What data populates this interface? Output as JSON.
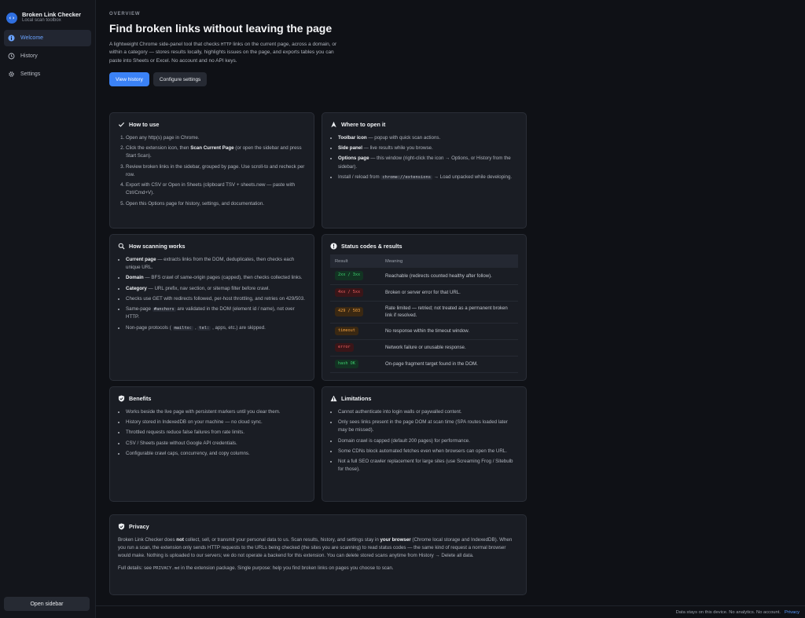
{
  "brand": {
    "title": "Broken Link Checker",
    "subtitle": "Local scan toolbox",
    "logo_glyph": "‹›"
  },
  "nav": {
    "items": [
      {
        "label": "Welcome",
        "icon": "info-icon",
        "active": true
      },
      {
        "label": "History",
        "icon": "history-icon"
      },
      {
        "label": "Settings",
        "icon": "gear-icon"
      }
    ]
  },
  "sidebar_button": "Open sidebar",
  "header": {
    "eyebrow": "OVERVIEW",
    "title": "Find broken links without leaving the page",
    "intro_1": "A lightweight Chrome side-panel tool that checks ",
    "intro_code": "HTTP",
    "intro_2": " links on the current page, across a domain, or within a category — stores results locally, highlights issues on the page, and exports tables you can paste into Sheets or Excel. No account and no API keys.",
    "btn_history": "View history",
    "btn_settings": "Configure settings"
  },
  "howto": {
    "title": "How to use",
    "s1": "Open any http(s) page in Chrome.",
    "s2a": "Click the extension icon, then ",
    "s2b": "Scan Current Page",
    "s2c": " (or open the sidebar and press Start Scan).",
    "s3": "Review broken links in the sidebar, grouped by page. Use scroll-to and recheck per row.",
    "s4": "Export with CSV or Open in Sheets (clipboard TSV + sheets.new — paste with Ctrl/Cmd+V).",
    "s5": "Open this Options page for history, settings, and documentation."
  },
  "where": {
    "title": "Where to open it",
    "i1b": "Toolbar icon",
    "i1": " — popup with quick scan actions.",
    "i2b": "Side panel",
    "i2": " — live results while you browse.",
    "i3b": "Options page",
    "i3": " — this window (right-click the icon → Options, or History from the sidebar).",
    "i4a": "Install / reload from ",
    "i4code": "chrome://extensions",
    "i4b": " → Load unpacked while developing."
  },
  "scanning": {
    "title": "How scanning works",
    "i1b": "Current page",
    "i1": " — extracts links from the DOM, deduplicates, then checks each unique URL.",
    "i2b": "Domain",
    "i2": " — BFS crawl of same-origin pages (capped), then checks collected links.",
    "i3b": "Category",
    "i3": " — URL prefix, nav section, or sitemap filter before crawl.",
    "i4": "Checks use GET with redirects followed, per-host throttling, and retries on 429/503.",
    "i5a": "Same-page ",
    "i5code": "#anchors",
    "i5b": " are validated in the DOM (element id / name), not over HTTP.",
    "i6a": "Non-page protocols ( ",
    "i6c1": "mailto:",
    "i6sep": " , ",
    "i6c2": "tel:",
    "i6b": " , apps, etc.) are skipped."
  },
  "status": {
    "title": "Status codes & results",
    "col_result": "Result",
    "col_meaning": "Meaning",
    "rows": [
      {
        "result": "2xx / 3xx",
        "meaning": "Reachable (redirects counted healthy after follow).",
        "color": "green"
      },
      {
        "result": "4xx / 5xx",
        "meaning": "Broken or server error for that URL.",
        "color": "red"
      },
      {
        "result": "429 / 503",
        "meaning": "Rate limited — retried; not treated as a permanent broken link if resolved.",
        "color": "orange"
      },
      {
        "result": "timeout",
        "meaning": "No response within the timeout window.",
        "color": "orange"
      },
      {
        "result": "error",
        "meaning": "Network failure or unusable response.",
        "color": "red"
      },
      {
        "result": "hash OK",
        "meaning": "On-page fragment target found in the DOM.",
        "color": "green"
      }
    ]
  },
  "benefits": {
    "title": "Benefits",
    "items": [
      "Works beside the live page with persistent markers until you clear them.",
      "History stored in IndexedDB on your machine — no cloud sync.",
      "Throttled requests reduce false failures from rate limits.",
      "CSV / Sheets paste without Google API credentials.",
      "Configurable crawl caps, concurrency, and copy columns."
    ]
  },
  "limitations": {
    "title": "Limitations",
    "items": [
      "Cannot authenticate into login walls or paywalled content.",
      "Only sees links present in the page DOM at scan time (SPA routes loaded later may be missed).",
      "Domain crawl is capped (default 200 pages) for performance.",
      "Some CDNs block automated fetches even when browsers can open the URL.",
      "Not a full SEO crawler replacement for large sites (use Screaming Frog / Sitebulb for those)."
    ]
  },
  "privacy": {
    "title": "Privacy",
    "p1a": "Broken Link Checker does ",
    "p1b": "not",
    "p1c": " collect, sell, or transmit your personal data to us. Scan results, history, and settings stay in ",
    "p1d": "your browser",
    "p1e": " (Chrome local storage and IndexedDB). When you run a scan, the extension only sends HTTP requests to the URLs being checked (the sites you are scanning) to read status codes — the same kind of request a normal browser would make. Nothing is uploaded to our servers; we do not operate a backend for this extension. You can delete stored scans anytime from History → Delete all data.",
    "p2a": "Full details: see ",
    "p2code": "PRIVACY.md",
    "p2b": " in the extension package. Single purpose: help you find broken links on pages you choose to scan."
  },
  "footer": {
    "text": "Data stays on this device. No analytics. No account.",
    "link": "Privacy"
  },
  "colors": {
    "accent": "#3b82f6",
    "link": "#5b9bff",
    "ok": "#3ecf6e",
    "bad": "#f06060",
    "warn": "#f0a040"
  }
}
